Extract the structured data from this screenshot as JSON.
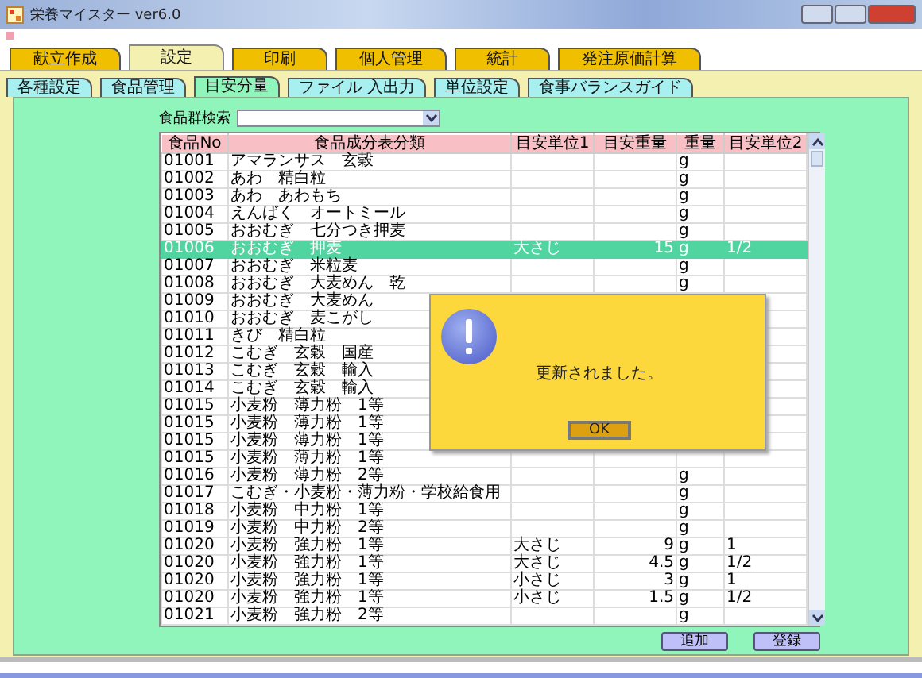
{
  "window": {
    "title": "栄養マイスター ver6.0"
  },
  "main_tabs": [
    {
      "label": "献立作成",
      "selected": false
    },
    {
      "label": "設定",
      "selected": true
    },
    {
      "label": "印刷",
      "selected": false
    },
    {
      "label": "個人管理",
      "selected": false
    },
    {
      "label": "統計",
      "selected": false
    },
    {
      "label": "発注原価計算",
      "selected": false
    }
  ],
  "sub_tabs": [
    {
      "label": "各種設定",
      "selected": false
    },
    {
      "label": "食品管理",
      "selected": false
    },
    {
      "label": "目安分量",
      "selected": true
    },
    {
      "label": "ファイル 入出力",
      "selected": false
    },
    {
      "label": "単位設定",
      "selected": false
    },
    {
      "label": "食事バランスガイド",
      "selected": false
    }
  ],
  "group_search": {
    "label": "食品群検索"
  },
  "table": {
    "columns": [
      "食品No",
      "食品成分表分類",
      "目安単位1",
      "目安重量",
      "重量",
      "目安単位2"
    ],
    "rows": [
      {
        "no": "01001",
        "name": "アマランサス　玄穀",
        "weight": "g",
        "selected": false
      },
      {
        "no": "01002",
        "name": "あわ　精白粒",
        "weight": "g",
        "selected": false
      },
      {
        "no": "01003",
        "name": "あわ　あわもち",
        "weight": "g",
        "selected": false
      },
      {
        "no": "01004",
        "name": "えんばく　オートミール",
        "weight": "g",
        "selected": false
      },
      {
        "no": "01005",
        "name": "おおむぎ　七分つき押麦",
        "weight": "g",
        "selected": false
      },
      {
        "no": "01006",
        "name": "おおむぎ　押麦",
        "unit1": "大さじ",
        "amount": "15",
        "weight": "g",
        "unit2": "1/2",
        "selected": true
      },
      {
        "no": "01007",
        "name": "おおむぎ　米粒麦",
        "weight": "g",
        "selected": false
      },
      {
        "no": "01008",
        "name": "おおむぎ　大麦めん　乾",
        "weight": "g",
        "selected": false
      },
      {
        "no": "01009",
        "name": "おおむぎ　大麦めん",
        "selected": false
      },
      {
        "no": "01010",
        "name": "おおむぎ　麦こがし",
        "selected": false
      },
      {
        "no": "01011",
        "name": "きび　精白粒",
        "selected": false
      },
      {
        "no": "01012",
        "name": "こむぎ　玄穀　国産",
        "selected": false
      },
      {
        "no": "01013",
        "name": "こむぎ　玄穀　輸入",
        "selected": false
      },
      {
        "no": "01014",
        "name": "こむぎ　玄穀　輸入",
        "selected": false
      },
      {
        "no": "01015",
        "name": "小麦粉　薄力粉　1等",
        "selected": false
      },
      {
        "no": "01015",
        "name": "小麦粉　薄力粉　1等",
        "selected": false
      },
      {
        "no": "01015",
        "name": "小麦粉　薄力粉　1等",
        "selected": false
      },
      {
        "no": "01015",
        "name": "小麦粉　薄力粉　1等",
        "selected": false
      },
      {
        "no": "01016",
        "name": "小麦粉　薄力粉　2等",
        "weight": "g",
        "selected": false
      },
      {
        "no": "01017",
        "name": "こむぎ・小麦粉・薄力粉・学校給食用",
        "weight": "g",
        "selected": false
      },
      {
        "no": "01018",
        "name": "小麦粉　中力粉　1等",
        "weight": "g",
        "selected": false
      },
      {
        "no": "01019",
        "name": "小麦粉　中力粉　2等",
        "weight": "g",
        "selected": false
      },
      {
        "no": "01020",
        "name": "小麦粉　強力粉　1等",
        "unit1": "大さじ",
        "amount": "9",
        "weight": "g",
        "unit2": "1",
        "selected": false
      },
      {
        "no": "01020",
        "name": "小麦粉　強力粉　1等",
        "unit1": "大さじ",
        "amount": "4.5",
        "weight": "g",
        "unit2": "1/2",
        "selected": false
      },
      {
        "no": "01020",
        "name": "小麦粉　強力粉　1等",
        "unit1": "小さじ",
        "amount": "3",
        "weight": "g",
        "unit2": "1",
        "selected": false
      },
      {
        "no": "01020",
        "name": "小麦粉　強力粉　1等",
        "unit1": "小さじ",
        "amount": "1.5",
        "weight": "g",
        "unit2": "1/2",
        "selected": false
      },
      {
        "no": "01021",
        "name": "小麦粉　強力粉　2等",
        "weight": "g",
        "selected": false
      }
    ]
  },
  "dialog": {
    "message": "更新されました。",
    "button": "OK"
  },
  "buttons": [
    "追加",
    "登録"
  ]
}
